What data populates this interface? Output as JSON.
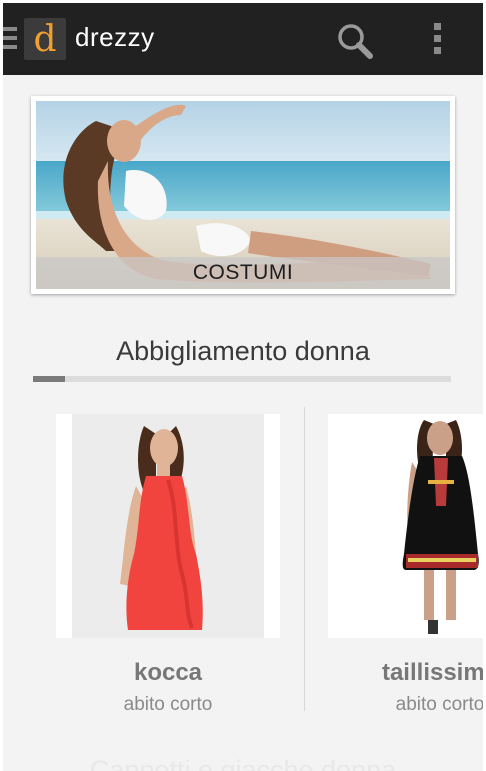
{
  "app": {
    "title": "drezzy",
    "logo_letter": "d",
    "accent": "#f0a030",
    "bar_color": "#212121"
  },
  "toolbar": {
    "search_icon": "search-icon",
    "menu_icon": "overflow-menu-icon"
  },
  "banner": {
    "label": "COSTUMI"
  },
  "section": {
    "title": "Abbigliamento donna"
  },
  "products": [
    {
      "name": "kocca",
      "type": "abito corto"
    },
    {
      "name": "taillissime",
      "type": "abito corto"
    }
  ],
  "next_section": {
    "title": "Cappotti e giacche donna"
  }
}
